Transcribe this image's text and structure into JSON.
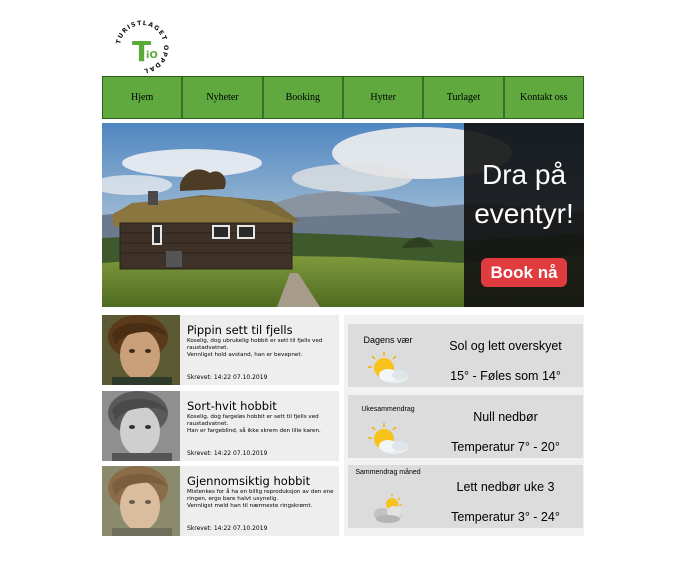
{
  "logo": {
    "ring_text": "TURISTLAGET OPPDAL",
    "letter_t": "T",
    "letter_io": "iO",
    "accent": "#5aaa3a"
  },
  "nav": {
    "items": [
      {
        "label": "Hjem"
      },
      {
        "label": "Nyheter"
      },
      {
        "label": "Booking"
      },
      {
        "label": "Hytter"
      },
      {
        "label": "Turlaget"
      },
      {
        "label": "Kontakt oss"
      }
    ],
    "bg_color": "#5fa93f"
  },
  "hero": {
    "title_line1": "Dra på",
    "title_line2": "eventyr!",
    "button_label": "Book nå",
    "button_color": "#e03b3f"
  },
  "articles": [
    {
      "title": "Pippin sett til fjells",
      "body": "Koselig, dog ubrukelig hobbit er sett til fjells ved raustadvatnet.\nVennligst hold avstand, han er bevepnet.",
      "date": "Skrevet: 14:22 07.10.2019",
      "image": "portrait-color"
    },
    {
      "title": "Sort-hvit hobbit",
      "body": "Koselig, dog fargeløs hobbit er sett til fjells ved raustadvatnet.\nHan er fargeblind, så ikke skrem den lille karen.",
      "date": "Skrevet: 14:22 07.10.2019",
      "image": "portrait-grayscale"
    },
    {
      "title": "Gjennomsiktig hobbit",
      "body": "Mistenkes for å ha en billig reproduksjon av den ene ringen, ergo bare halvt usynelig.\nVennligst meld han til nærmeste ringskrømt.",
      "date": "Skrevet: 14:22 07.10.2019",
      "image": "portrait-faded"
    }
  ],
  "weather": [
    {
      "label": "Dagens vær",
      "icon": "sun-cloud-icon",
      "line1": "Sol og lett overskyet",
      "line2": "15° - Føles som 14°"
    },
    {
      "label": "Ukesammendrag",
      "icon": "sun-cloud-icon",
      "line1": "Null nedbør",
      "line2": "Temperatur 7° - 20°"
    },
    {
      "label": "Sammendrag måned",
      "icon": "cloud-sun-icon",
      "line1": "Lett nedbør uke 3",
      "line2": "Temperatur 3° - 24°"
    }
  ]
}
